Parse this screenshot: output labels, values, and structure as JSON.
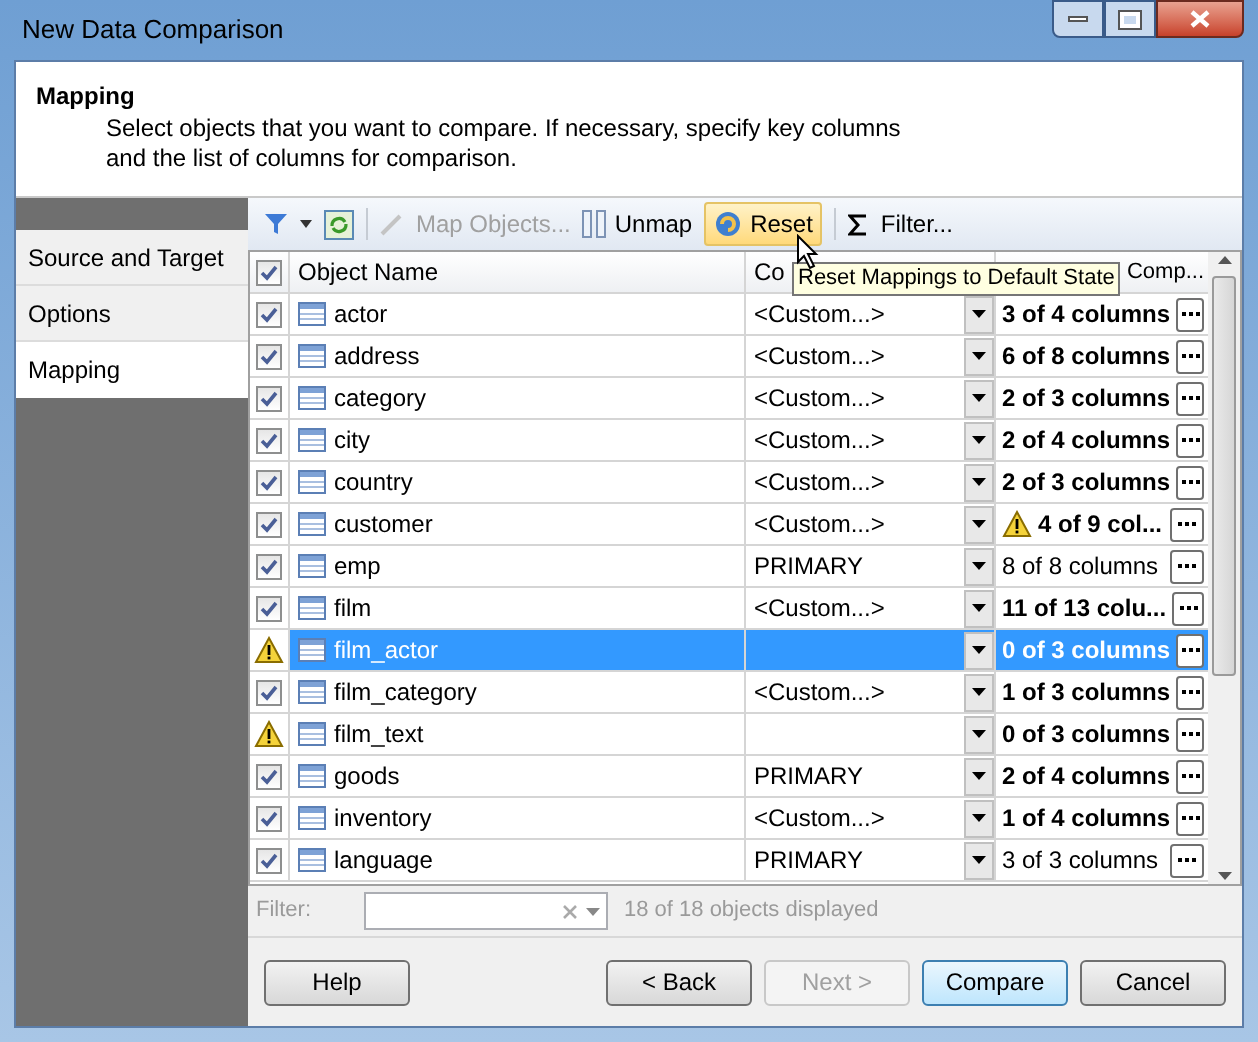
{
  "window": {
    "title": "New Data Comparison"
  },
  "header": {
    "title": "Mapping",
    "description": "Select objects that you want to compare. If necessary, specify key columns and the list of columns for comparison."
  },
  "sidebar": {
    "items": [
      {
        "label": "Source and Target",
        "selected": false
      },
      {
        "label": "Options",
        "selected": false
      },
      {
        "label": "Mapping",
        "selected": true
      }
    ]
  },
  "toolbar": {
    "map_objects": "Map Objects...",
    "unmap": "Unmap",
    "reset": "Reset",
    "filter": "Filter...",
    "tooltip": "Reset Mappings to Default State"
  },
  "table": {
    "all_checked": true,
    "columns": [
      "Object Name",
      "Co",
      "Comp..."
    ],
    "rows": [
      {
        "kind": "checkbox",
        "checked": true,
        "name": "actor",
        "key": "<Custom...>",
        "columns": "3 of 4 columns",
        "bold": true,
        "warning": false,
        "selected": false
      },
      {
        "kind": "checkbox",
        "checked": true,
        "name": "address",
        "key": "<Custom...>",
        "columns": "6 of 8 columns",
        "bold": true,
        "warning": false,
        "selected": false
      },
      {
        "kind": "checkbox",
        "checked": true,
        "name": "category",
        "key": "<Custom...>",
        "columns": "2 of 3 columns",
        "bold": true,
        "warning": false,
        "selected": false
      },
      {
        "kind": "checkbox",
        "checked": true,
        "name": "city",
        "key": "<Custom...>",
        "columns": "2 of 4 columns",
        "bold": true,
        "warning": false,
        "selected": false
      },
      {
        "kind": "checkbox",
        "checked": true,
        "name": "country",
        "key": "<Custom...>",
        "columns": "2 of 3 columns",
        "bold": true,
        "warning": false,
        "selected": false
      },
      {
        "kind": "checkbox",
        "checked": true,
        "name": "customer",
        "key": "<Custom...>",
        "columns": "4 of 9 col...",
        "bold": true,
        "warning": true,
        "selected": false
      },
      {
        "kind": "checkbox",
        "checked": true,
        "name": "emp",
        "key": "PRIMARY",
        "columns": "8 of 8 columns",
        "bold": false,
        "warning": false,
        "selected": false
      },
      {
        "kind": "checkbox",
        "checked": true,
        "name": "film",
        "key": "<Custom...>",
        "columns": "11 of 13 colu...",
        "bold": true,
        "warning": false,
        "selected": false
      },
      {
        "kind": "warning",
        "name": "film_actor",
        "columns": "0 of 3 columns",
        "bold": true,
        "warning": false,
        "selected": true
      },
      {
        "kind": "checkbox",
        "checked": true,
        "name": "film_category",
        "key": "<Custom...>",
        "columns": "1 of 3 columns",
        "bold": true,
        "warning": false,
        "selected": false
      },
      {
        "kind": "warning",
        "name": "film_text",
        "columns": "0 of 3 columns",
        "bold": true,
        "warning": false,
        "selected": false
      },
      {
        "kind": "checkbox",
        "checked": true,
        "name": "goods",
        "key": "PRIMARY",
        "columns": "2 of 4 columns",
        "bold": true,
        "warning": false,
        "selected": false
      },
      {
        "kind": "checkbox",
        "checked": true,
        "name": "inventory",
        "key": "<Custom...>",
        "columns": "1 of 4 columns",
        "bold": true,
        "warning": false,
        "selected": false
      },
      {
        "kind": "checkbox",
        "checked": true,
        "name": "language",
        "key": "PRIMARY",
        "columns": "3 of 3 columns",
        "bold": false,
        "warning": false,
        "selected": false
      }
    ]
  },
  "filter": {
    "label": "Filter:",
    "status": "18 of 18 objects displayed"
  },
  "buttons": [
    {
      "label": "Help",
      "kind": "normal"
    },
    {
      "label": "< Back",
      "kind": "normal"
    },
    {
      "label": "Next >",
      "kind": "disabled"
    },
    {
      "label": "Compare",
      "kind": "default"
    },
    {
      "label": "Cancel",
      "kind": "normal"
    }
  ]
}
